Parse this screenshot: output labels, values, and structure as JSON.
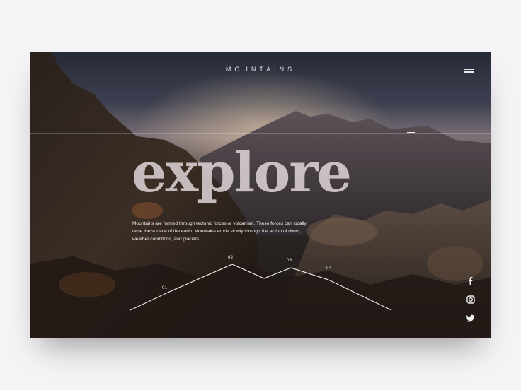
{
  "brand": {
    "logo_text": "MOUNTAINS"
  },
  "hero": {
    "title": "explore",
    "description": "Mountains are formed through tectonic forces or volcanism. These forces can locally raise the surface of the earth. Mountains erode slowly through the action of rivers, weather conditions, and glaciers."
  },
  "peaks": [
    {
      "label": "01"
    },
    {
      "label": "02"
    },
    {
      "label": "03"
    },
    {
      "label": "04"
    }
  ],
  "social": [
    "facebook-icon",
    "instagram-icon",
    "twitter-icon"
  ],
  "colors": {
    "text": "#f1eeee",
    "accent_line": "#ffffff",
    "background": "#f4f4f6"
  }
}
